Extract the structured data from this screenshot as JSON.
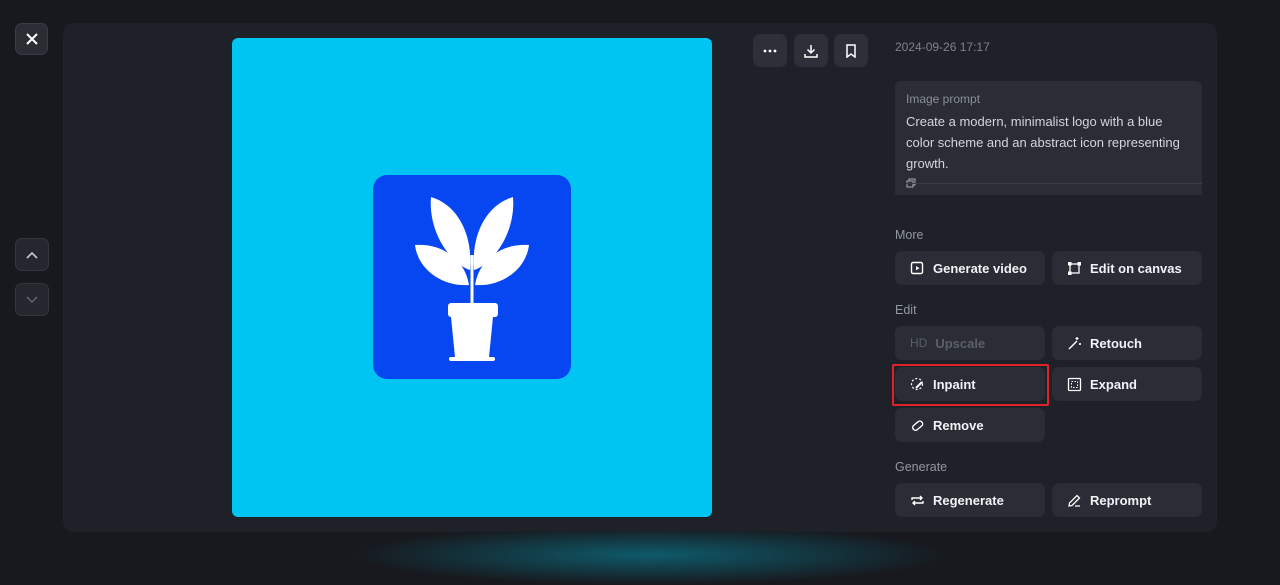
{
  "header": {
    "timestamp": "2024-09-26 17:17"
  },
  "prompt": {
    "label": "Image prompt",
    "text": "Create a modern, minimalist logo with a blue color scheme and an abstract icon representing growth."
  },
  "sections": {
    "more": "More",
    "edit": "Edit",
    "generate": "Generate"
  },
  "buttons": {
    "generate_video": "Generate video",
    "edit_on_canvas": "Edit on canvas",
    "upscale": "Upscale",
    "upscale_badge": "HD",
    "retouch": "Retouch",
    "inpaint": "Inpaint",
    "expand": "Expand",
    "remove": "Remove",
    "regenerate": "Regenerate",
    "reprompt": "Reprompt"
  },
  "colors": {
    "image_bg": "#00c4f2",
    "logo_bg": "#0747f2",
    "highlight": "#e0222a"
  }
}
